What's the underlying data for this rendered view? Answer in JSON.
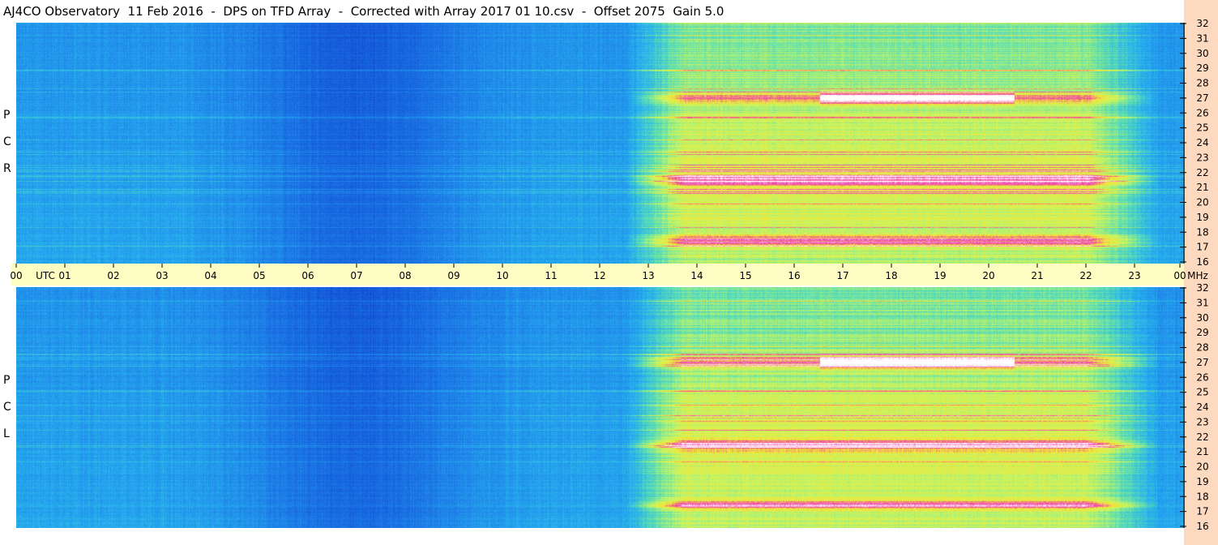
{
  "title": "AJ4CO Observatory  11 Feb 2016  -  DPS on TFD Array  -  Corrected with Array 2017 01 10.csv  -  Offset 2075  Gain 5.0",
  "chart_data": {
    "type": "heatmap",
    "title": "AJ4CO Observatory  11 Feb 2016  -  DPS on TFD Array  -  Corrected with Array 2017 01 10.csv  -  Offset 2075  Gain 5.0",
    "x_ticks": [
      "00",
      "UTC",
      "01",
      "02",
      "03",
      "04",
      "05",
      "06",
      "07",
      "08",
      "09",
      "10",
      "11",
      "12",
      "13",
      "14",
      "15",
      "16",
      "17",
      "18",
      "19",
      "20",
      "21",
      "22",
      "23",
      "00",
      "MHz"
    ],
    "xlim": [
      0,
      24
    ],
    "xunit": "UTC",
    "y_ticks": [
      "32",
      "31",
      "30",
      "29",
      "28",
      "27",
      "26",
      "25",
      "24",
      "23",
      "22",
      "21",
      "20",
      "19",
      "18",
      "17",
      "16"
    ],
    "ylim": [
      16,
      32
    ],
    "yunit": "MHz",
    "panels": [
      {
        "name": "RCP",
        "label_letters": [
          "R",
          "C",
          "P"
        ]
      },
      {
        "name": "LCP",
        "label_letters": [
          "L",
          "C",
          "P"
        ]
      }
    ],
    "colormap": [
      "#0a2e9e",
      "#1456d8",
      "#1e7fe8",
      "#27b0ef",
      "#5fe0b0",
      "#c9f560",
      "#f2e638",
      "#ee3fa8",
      "#ffffff"
    ],
    "colors": {
      "time_bar": "#fefcc2",
      "right_strip": "#fcd9bf"
    },
    "features": {
      "quiet_background_utc": [
        0,
        12
      ],
      "darkest_utc": [
        5,
        9
      ],
      "noise_storm_utc": [
        12.5,
        23.5
      ],
      "strongest_bands_mhz": [
        27,
        21.5,
        17.5
      ],
      "bright_core_utc": [
        16.5,
        20.5
      ]
    }
  }
}
